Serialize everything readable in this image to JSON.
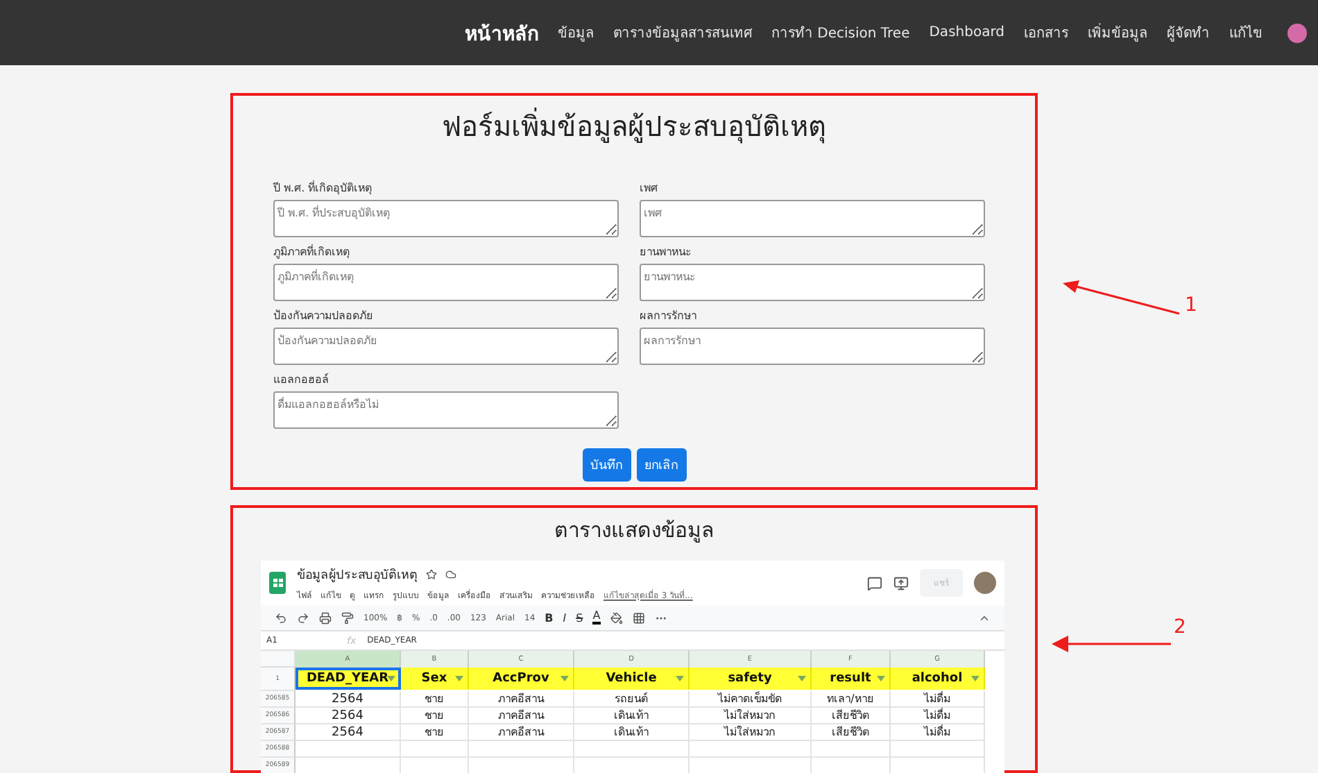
{
  "navbar": {
    "brand": "หน้าหลัก",
    "links": [
      "ข้อมูล",
      "ตารางข้อมูลสารสนเทศ",
      "การทำ Decision Tree",
      "Dashboard",
      "เอกสาร",
      "เพิ่มข้อมูล",
      "ผู้จัดทำ",
      "แก้ไข"
    ]
  },
  "form": {
    "title": "ฟอร์มเพิ่มข้อมูลผู้ประสบอุบัติเหตุ",
    "annotation": "1",
    "fields": [
      {
        "label": "ปี พ.ศ. ที่เกิดอุบัติเหตุ",
        "placeholder": "ปี พ.ศ. ที่ประสบอุบัติเหตุ"
      },
      {
        "label": "เพศ",
        "placeholder": "เพศ"
      },
      {
        "label": "ภูมิภาคที่เกิดเหตุ",
        "placeholder": "ภูมิภาคที่เกิดเหตุ"
      },
      {
        "label": "ยานพาหนะ",
        "placeholder": "ยานพาหนะ"
      },
      {
        "label": "ป้องกันความปลอดภัย",
        "placeholder": "ป้องกันความปลอดภัย"
      },
      {
        "label": "ผลการรักษา",
        "placeholder": "ผลการรักษา"
      },
      {
        "label": "แอลกอฮอล์",
        "placeholder": "ดื่มแอลกอฮอล์หรือไม่"
      }
    ],
    "buttons": [
      "บันทึก",
      "ยกเลิก"
    ]
  },
  "table_section": {
    "title": "ตารางแสดงข้อมูล",
    "annotation": "2",
    "sheet": {
      "title": "ข้อมูลผู้ประสบอุบัติเหตุ",
      "menu": [
        "ไฟล์",
        "แก้ไข",
        "ดู",
        "แทรก",
        "รูปแบบ",
        "ข้อมูล",
        "เครื่องมือ",
        "ส่วนเสริม",
        "ความช่วยเหลือ"
      ],
      "last_edit": "แก้ไขล่าสุดเมื่อ 3 วันที่...",
      "share": "แชร์",
      "toolbar": {
        "zoom": "100%",
        "currency": "฿",
        "percent": "%",
        "dec_less": ".0",
        "dec_more": ".00",
        "number_format": "123",
        "font": "Arial",
        "size": "14",
        "bold": "B",
        "italic": "I",
        "strike": "S",
        "text_color": "A"
      },
      "name_box": "A1",
      "fx": "fx",
      "formula": "DEAD_YEAR",
      "column_letters": [
        "A",
        "B",
        "C",
        "D",
        "E",
        "F",
        "G"
      ],
      "header_row": {
        "number": "1",
        "cells": [
          "DEAD_YEAR",
          "Sex",
          "AccProv",
          "Vehicle",
          "safety",
          "result",
          "alcohol"
        ]
      },
      "rows": [
        {
          "number": "206585",
          "cells": [
            "2564",
            "ชาย",
            "ภาคอีสาน",
            "รถยนต์",
            "ไม่คาดเข็มขัด",
            "ทเลา/หาย",
            "ไม่ดื่ม"
          ]
        },
        {
          "number": "206586",
          "cells": [
            "2564",
            "ชาย",
            "ภาคอีสาน",
            "เดินเท้า",
            "ไม่ใส่หมวก",
            "เสียชีวิต",
            "ไม่ดื่ม"
          ]
        },
        {
          "number": "206587",
          "cells": [
            "2564",
            "ชาย",
            "ภาคอีสาน",
            "เดินเท้า",
            "ไม่ใส่หมวก",
            "เสียชีวิต",
            "ไม่ดื่ม"
          ]
        }
      ],
      "empty_rows": [
        "206588",
        "206589"
      ]
    }
  }
}
